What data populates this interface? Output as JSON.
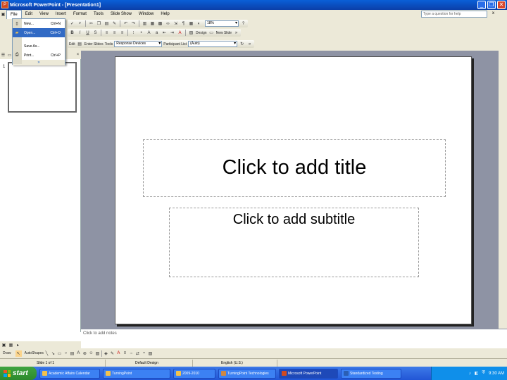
{
  "window": {
    "title": "Microsoft PowerPoint - [Presentation1]",
    "buttons": {
      "minimize": "_",
      "restore": "❐",
      "close": "✕"
    }
  },
  "menubar": {
    "items": [
      "File",
      "Edit",
      "View",
      "Insert",
      "Format",
      "Tools",
      "Slide Show",
      "Window",
      "Help"
    ],
    "help_placeholder": "Type a question for help",
    "close_doc": "x"
  },
  "file_menu": {
    "items": [
      {
        "label": "New...",
        "shortcut": "Ctrl+N",
        "icon": "new-doc-icon"
      },
      {
        "label": "Open...",
        "shortcut": "Ctrl+O",
        "icon": "open-folder-icon"
      },
      {
        "label": "Save As...",
        "shortcut": "",
        "icon": ""
      },
      {
        "label": "Print...",
        "shortcut": "Ctrl+P",
        "icon": "print-icon"
      }
    ],
    "expand": "»"
  },
  "toolbar1": {
    "font_size": "18%"
  },
  "toolbar2": {
    "design_label": "Design",
    "new_slide_label": "New Slide"
  },
  "toolbar3": {
    "edit_label": "Edit",
    "showall_label": "Enter Slides",
    "tools_label": "Tools",
    "font": "Response Devices",
    "participants_label": "Participant List",
    "session": "(Auto)"
  },
  "slide": {
    "number": "1",
    "title_placeholder": "Click to add title",
    "subtitle_placeholder": "Click to add subtitle"
  },
  "notes": {
    "placeholder": "Click to add notes"
  },
  "drawbar": {
    "draw_label": "Draw",
    "autoshapes_label": "AutoShapes"
  },
  "statusbar": {
    "slide": "Slide 1 of 1",
    "design": "Default Design",
    "language": "English (U.S.)"
  },
  "taskbar": {
    "start": "start",
    "tasks": [
      {
        "label": "Academic Affairs Calendar"
      },
      {
        "label": "TurningPoint"
      },
      {
        "label": "2009-2010"
      },
      {
        "label": "TurningPoint Technologies"
      },
      {
        "label": "Microsoft PowerPoint",
        "active": true
      },
      {
        "label": "Standardized Testing"
      }
    ],
    "clock": "9:30 AM"
  },
  "colors": {
    "titlebar": "#0b50c8",
    "workarea": "#8e93a4",
    "taskbar": "#2a62dc",
    "start": "#3a9a3a",
    "highlight": "#316ac5"
  }
}
